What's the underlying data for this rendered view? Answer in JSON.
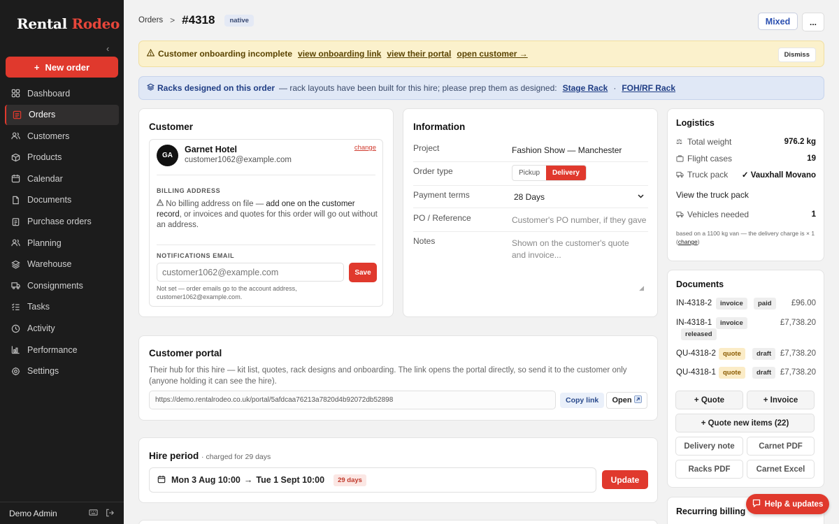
{
  "brand": {
    "part1": "Rental",
    "part2": "Rodeo"
  },
  "sidebar": {
    "new_order": "New order",
    "items": [
      {
        "label": "Dashboard",
        "icon": "grid-icon"
      },
      {
        "label": "Orders",
        "icon": "orders-icon",
        "active": true
      },
      {
        "label": "Customers",
        "icon": "people-icon"
      },
      {
        "label": "Products",
        "icon": "box-icon"
      },
      {
        "label": "Calendar",
        "icon": "calendar-icon"
      },
      {
        "label": "Documents",
        "icon": "document-icon"
      },
      {
        "label": "Purchase orders",
        "icon": "clipboard-icon"
      },
      {
        "label": "Planning",
        "icon": "people-icon"
      },
      {
        "label": "Warehouse",
        "icon": "layers-icon"
      },
      {
        "label": "Consignments",
        "icon": "truck-icon"
      },
      {
        "label": "Tasks",
        "icon": "checklist-icon"
      },
      {
        "label": "Activity",
        "icon": "clock-icon"
      },
      {
        "label": "Performance",
        "icon": "bar-chart-icon"
      },
      {
        "label": "Settings",
        "icon": "gear-icon"
      }
    ],
    "user": "Demo Admin"
  },
  "header": {
    "crumb": "Orders",
    "sep": ">",
    "order_id": "#4318",
    "badge": "native",
    "mixed": "Mixed",
    "more": "..."
  },
  "onboarding": {
    "text": "Customer onboarding incomplete",
    "link1": "view onboarding link",
    "link2": "view their portal",
    "link3": "open customer →",
    "dismiss": "Dismiss"
  },
  "racks": {
    "title": "Racks designed on this order",
    "text": "— rack layouts have been built for this hire; please prep them as designed:",
    "link1": "Stage Rack",
    "dot": "·",
    "link2": "FOH/RF Rack"
  },
  "customer": {
    "title": "Customer",
    "initials": "GA",
    "name": "Garnet Hotel",
    "email": "customer1062@example.com",
    "change": "change",
    "billing_label": "BILLING ADDRESS",
    "billing_pre": "No billing address on file —",
    "billing_link": "add one on the customer record",
    "billing_post": ", or invoices and quotes for this order will go out without an address.",
    "notif_label": "NOTIFICATIONS EMAIL",
    "notif_placeholder": "customer1062@example.com",
    "save": "Save",
    "notset": "Not set — order emails go to the account address, customer1062@example.com."
  },
  "information": {
    "title": "Information",
    "project_label": "Project",
    "project_value": "Fashion Show — Manchester",
    "order_type_label": "Order type",
    "order_type_options": [
      "Pickup",
      "Delivery"
    ],
    "order_type_selected": "Delivery",
    "payment_label": "Payment terms",
    "payment_value": "28 Days",
    "po_label": "PO / Reference",
    "po_placeholder": "Customer's PO number, if they gave",
    "notes_label": "Notes",
    "notes_placeholder": "Shown on the customer's quote and invoice..."
  },
  "logistics": {
    "title": "Logistics",
    "weight_label": "Total weight",
    "weight_value": "976.2 kg",
    "cases_label": "Flight cases",
    "cases_value": "19",
    "truck_label": "Truck pack",
    "truck_value": "✓ Vauxhall Movano",
    "truck_link": "View the truck pack",
    "vehicles_label": "Vehicles needed",
    "vehicles_value": "1",
    "note_pre": "based on a 1100 kg van — the delivery charge is × 1 (",
    "note_link": "change",
    "note_post": ")"
  },
  "documents": {
    "title": "Documents",
    "rows": [
      {
        "num": "IN-4318-2",
        "type": "invoice",
        "status": "paid",
        "amount": "£96.00"
      },
      {
        "num": "IN-4318-1",
        "type": "invoice",
        "status": "released",
        "amount": "£7,738.20"
      },
      {
        "num": "QU-4318-2",
        "type": "quote",
        "status": "draft",
        "amount": "£7,738.20"
      },
      {
        "num": "QU-4318-1",
        "type": "quote",
        "status": "draft",
        "amount": "£7,738.20"
      }
    ],
    "add_quote": "+ Quote",
    "add_invoice": "+ Invoice",
    "quote_new": "+ Quote new items (22)",
    "delivery_note": "Delivery note",
    "carnet_pdf": "Carnet PDF",
    "racks_pdf": "Racks PDF",
    "carnet_excel": "Carnet Excel"
  },
  "recurring": {
    "title": "Recurring billing"
  },
  "portal": {
    "title": "Customer portal",
    "text": "Their hub for this hire — kit list, quotes, rack designs and onboarding. The link opens the portal directly, so send it to the customer only (anyone holding it can see the hire).",
    "url": "https://demo.rentalrodeo.co.uk/portal/5afdcaa76213a7820d4b92072db52898",
    "copy": "Copy link",
    "open": "Open"
  },
  "hire": {
    "title": "Hire period",
    "subtitle": "· charged for 29 days",
    "start": "Mon 3 Aug 10:00",
    "arrow": "→",
    "end": "Tue 1 Sept 10:00",
    "days": "29 days",
    "update": "Update"
  },
  "help": {
    "label": "Help & updates"
  },
  "colors": {
    "accent": "#e0392d",
    "sidebar": "#1c1c1c",
    "link_blue": "#1f3d84"
  }
}
